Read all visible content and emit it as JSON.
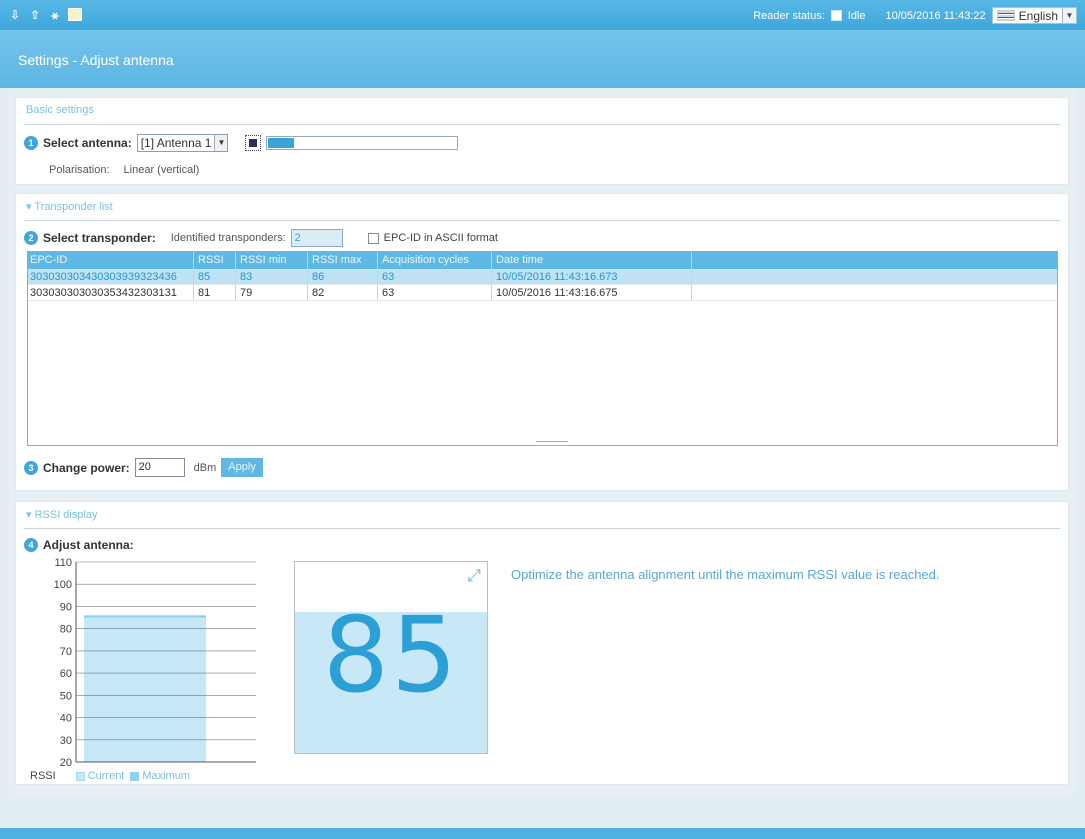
{
  "topbar": {
    "reader_status_label": "Reader status:",
    "reader_status_value": "Idle",
    "datetime": "10/05/2016 11:43:22",
    "language": "English"
  },
  "header": {
    "title": "Settings - Adjust antenna"
  },
  "basic": {
    "title": "Basic settings",
    "select_antenna_label": "Select antenna:",
    "antenna_value": "[1] Antenna 1",
    "polarisation_label": "Polarisation:",
    "polarisation_value": "Linear (vertical)"
  },
  "transponder": {
    "title": "Transponder list",
    "select_label": "Select transponder:",
    "identified_label": "Identified transponders:",
    "identified_value": "2",
    "ascii_label": "EPC-ID in ASCII format",
    "columns": [
      "EPC-ID",
      "RSSI",
      "RSSI min",
      "RSSI max",
      "Acquisition cycles",
      "Date time"
    ],
    "rows": [
      [
        "303030303430303939323436",
        "85",
        "83",
        "86",
        "63",
        "10/05/2016 11:43:16.673"
      ],
      [
        "303030303030353432303131",
        "81",
        "79",
        "82",
        "63",
        "10/05/2016 11:43:16.675"
      ]
    ],
    "change_power_label": "Change power:",
    "power_value": "20",
    "power_unit": "dBm",
    "apply_label": "Apply"
  },
  "rssi": {
    "title": "RSSI display",
    "adjust_label": "Adjust antenna:",
    "big_value": "85",
    "hint": "Optimize the antenna alignment until the maximum RSSI value is reached.",
    "legend_rssi": "RSSI",
    "legend_current": "Current",
    "legend_maximum": "Maximum"
  },
  "chart_data": {
    "type": "bar",
    "categories": [
      "RSSI"
    ],
    "series": [
      {
        "name": "Current",
        "values": [
          85
        ]
      },
      {
        "name": "Maximum",
        "values": [
          86
        ]
      }
    ],
    "ylim": [
      20,
      110
    ],
    "yticks": [
      20,
      30,
      40,
      50,
      60,
      70,
      80,
      90,
      100,
      110
    ],
    "grid": true,
    "colors": {
      "current": "#c5e7f6",
      "maximum": "#8fd0ee"
    }
  },
  "colors": {
    "accent": "#3fa6db",
    "selected_row": "#bfe3f5"
  }
}
